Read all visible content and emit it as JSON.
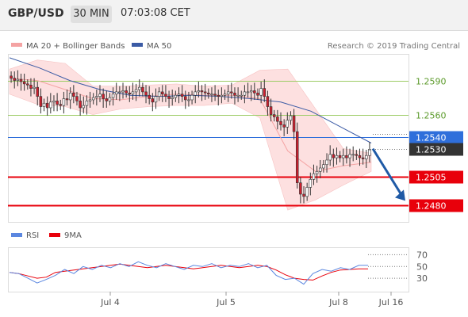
{
  "header": {
    "pair": "GBP/USD",
    "timeframe": "30 MIN",
    "time": "07:03:08 CET"
  },
  "legend": {
    "ma20_bb": "MA 20 + Bollinger Bands",
    "ma50": "MA 50",
    "rsi": "RSI",
    "ma9": "9MA"
  },
  "source": "Research © 2019 Trading Central",
  "colors": {
    "up": "#ffffff",
    "down": "#cc1f2e",
    "candle_edge": "#333333",
    "bb_fill": "#fde0e0",
    "ma20": "#f4a3a3",
    "ma50": "#3b5ba5",
    "resistance": "#9ccc65",
    "support": "#e8000b",
    "pivot": "#2f6fdb",
    "price_tag": "#333333",
    "rsi": "#5b87e0",
    "rsi_ma": "#e8000b"
  },
  "chart_data": {
    "type": "candlestick",
    "y_range": [
      1.2467,
      1.2612
    ],
    "x_ticks": [
      "Jul 4",
      "Jul 5",
      "Jul 8",
      "Jul 16"
    ],
    "levels": [
      {
        "label": "1.2590",
        "value": 1.259,
        "kind": "resistance"
      },
      {
        "label": "1.2560",
        "value": 1.256,
        "kind": "resistance"
      },
      {
        "label": "1.2540",
        "value": 1.254,
        "kind": "pivot"
      },
      {
        "label": "1.2530",
        "value": 1.253,
        "kind": "last-price"
      },
      {
        "label": "1.2505",
        "value": 1.2505,
        "kind": "support"
      },
      {
        "label": "1.2480",
        "value": 1.248,
        "kind": "support"
      }
    ],
    "candle_closes": [
      1.2592,
      1.259,
      1.2591,
      1.2589,
      1.2587,
      1.2586,
      1.2583,
      1.2584,
      1.2576,
      1.2567,
      1.257,
      1.2566,
      1.2571,
      1.2572,
      1.2569,
      1.2568,
      1.2574,
      1.2573,
      1.2579,
      1.2576,
      1.2572,
      1.2566,
      1.2568,
      1.2572,
      1.2573,
      1.2575,
      1.2576,
      1.2578,
      1.2574,
      1.2572,
      1.2575,
      1.2578,
      1.258,
      1.258,
      1.2581,
      1.2579,
      1.2578,
      1.258,
      1.2582,
      1.2584,
      1.258,
      1.2577,
      1.2574,
      1.2571,
      1.2576,
      1.258,
      1.2578,
      1.2576,
      1.2574,
      1.2575,
      1.2577,
      1.2578,
      1.2576,
      1.2573,
      1.2573,
      1.2577,
      1.258,
      1.2581,
      1.258,
      1.2579,
      1.2578,
      1.2578,
      1.2577,
      1.2576,
      1.2577,
      1.2578,
      1.258,
      1.2579,
      1.2577,
      1.2577,
      1.2577,
      1.258,
      1.258,
      1.2581,
      1.2579,
      1.2577,
      1.2583,
      1.2576,
      1.2567,
      1.256,
      1.2558,
      1.2554,
      1.2551,
      1.2549,
      1.2555,
      1.2559,
      1.2545,
      1.25,
      1.249,
      1.2488,
      1.2496,
      1.2503,
      1.2508,
      1.251,
      1.2513,
      1.2516,
      1.252,
      1.2525,
      1.2522,
      1.2524,
      1.2522,
      1.2524,
      1.2522,
      1.2525,
      1.2525,
      1.2524,
      1.2522,
      1.2521,
      1.2524,
      1.2529
    ],
    "ma50": [
      1.261,
      1.2601,
      1.259,
      1.2582,
      1.2577,
      1.2576,
      1.2577,
      1.2576,
      1.2574,
      1.2571,
      1.2563,
      1.2549,
      1.2535
    ],
    "bb_upper": [
      1.26,
      1.2608,
      1.2605,
      1.2585,
      1.2585,
      1.2586,
      1.2587,
      1.2585,
      1.2586,
      1.2599,
      1.26,
      1.2565,
      1.253,
      1.2526
    ],
    "bb_lower": [
      1.2578,
      1.2569,
      1.2567,
      1.256,
      1.2565,
      1.2567,
      1.2568,
      1.2568,
      1.257,
      1.2557,
      1.2476,
      1.2485,
      1.2498,
      1.251
    ],
    "ma20": [
      1.2592,
      1.259,
      1.2582,
      1.2574,
      1.2573,
      1.2576,
      1.2578,
      1.2577,
      1.2577,
      1.2574,
      1.2528,
      1.251,
      1.2515,
      1.2518
    ],
    "rsi_panel": {
      "y_ticks": [
        70,
        50,
        30
      ],
      "rsi": [
        40,
        38,
        30,
        22,
        28,
        35,
        45,
        38,
        50,
        45,
        52,
        48,
        55,
        50,
        58,
        52,
        48,
        55,
        50,
        45,
        52,
        50,
        55,
        48,
        52,
        50,
        55,
        48,
        52,
        35,
        28,
        30,
        20,
        38,
        45,
        42,
        48,
        45,
        52,
        52
      ],
      "ma9": [
        40,
        38,
        34,
        30,
        32,
        40,
        42,
        44,
        46,
        48,
        50,
        52,
        54,
        52,
        50,
        48,
        50,
        52,
        50,
        48,
        46,
        48,
        50,
        52,
        50,
        48,
        50,
        52,
        50,
        44,
        36,
        30,
        28,
        27,
        34,
        40,
        44,
        45,
        46,
        46
      ]
    }
  }
}
